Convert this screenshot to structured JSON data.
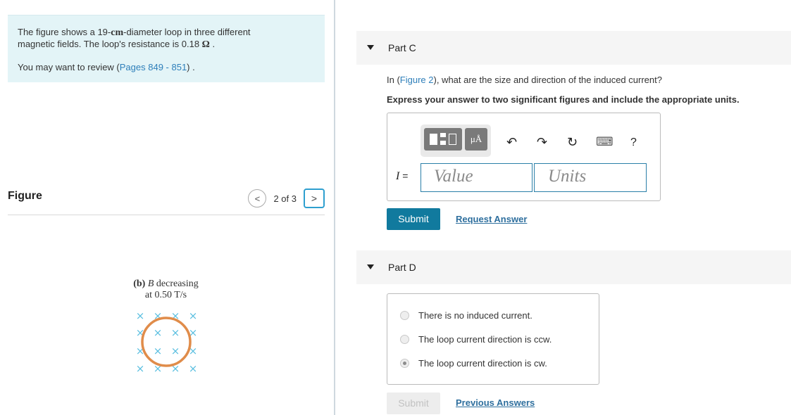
{
  "intro": {
    "line1_pre": "The figure shows a 19-",
    "line1_unit": "cm",
    "line1_post": "-diameter loop in three different",
    "line2_pre": "magnetic fields. The loop's resistance is 0.18 ",
    "line2_unit": "Ω",
    "line2_post": " .",
    "review_pre": "You may want to review (",
    "review_link": "Pages 849 - 851",
    "review_post": ") ."
  },
  "figure_panel": {
    "title": "Figure",
    "page_count": "2 of 3",
    "prev_glyph": "<",
    "next_glyph": ">",
    "caption_label": "(b)",
    "caption_var": "B",
    "caption_word": " decreasing",
    "caption_rate": "at 0.50 T/s",
    "field_glyph": "×"
  },
  "partC": {
    "title": "Part C",
    "question_pre": "In (",
    "question_link": "Figure 2",
    "question_post": "), what are the size and direction of the induced current?",
    "instruction": "Express your answer to two significant figures and include the appropriate units.",
    "toolbar_units_glyph": "μÅ",
    "icons": {
      "undo": "↶",
      "redo": "↷",
      "reset": "↻",
      "keyboard": "⌨",
      "help": "?"
    },
    "equation_var": "I",
    "equation_eq": " =",
    "value_placeholder": "Value",
    "units_placeholder": "Units",
    "submit_label": "Submit",
    "request_label": "Request Answer"
  },
  "partD": {
    "title": "Part D",
    "options": [
      {
        "label": "There is no induced current.",
        "selected": false
      },
      {
        "label": "The loop current direction is ccw.",
        "selected": false
      },
      {
        "label": "The loop current direction is cw.",
        "selected": true
      }
    ],
    "submit_label": "Submit",
    "previous_label": "Previous Answers"
  },
  "colors": {
    "accent": "#117a9e",
    "link": "#2e7fba",
    "loop": "#e08c4a",
    "field": "#5bbfe0"
  }
}
